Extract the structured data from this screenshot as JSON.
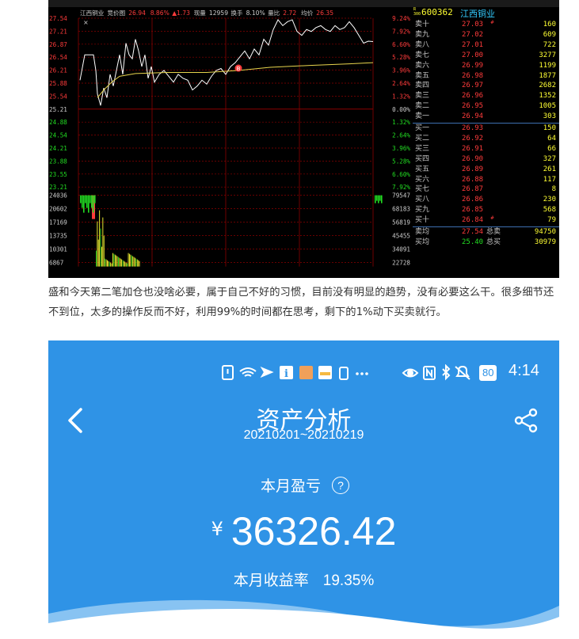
{
  "terminal": {
    "stock_name": "江西铜业",
    "chart_label": "竞价图",
    "header": {
      "price": "26.94",
      "change_pct": "8.86%",
      "change_arrow": "▲",
      "change_amount": "1.73",
      "volume_label": "现量",
      "volume": "12959",
      "turnover_label": "换手",
      "turnover": "8.10%",
      "vol_ratio_label": "量比",
      "vol_ratio": "2.72",
      "avg_label": "均价",
      "avg_price": "26.35"
    },
    "price_axis_left": [
      "27.54",
      "27.21",
      "26.87",
      "26.54",
      "26.21",
      "25.88",
      "25.54",
      "25.21",
      "24.88",
      "24.54",
      "24.21",
      "23.88",
      "23.55",
      "23.21"
    ],
    "price_axis_right": [
      "9.24%",
      "7.92%",
      "6.60%",
      "5.28%",
      "3.96%",
      "2.64%",
      "1.32%",
      "0.00%",
      "1.32%",
      "2.64%",
      "3.96%",
      "5.28%",
      "6.60%",
      "7.92%"
    ],
    "volume_axis_left": [
      "24036",
      "20602",
      "17169",
      "13735",
      "10301",
      "6867"
    ],
    "volume_axis_right": [
      "79547",
      "68183",
      "56819",
      "45455",
      "34091",
      "22728"
    ],
    "buy_marker": "B",
    "book": {
      "code": "600362",
      "code_prefix": "R\n300",
      "name": "江西铜业",
      "sells": [
        {
          "label": "卖十",
          "price": "27.03",
          "flag": "#",
          "vol": "160"
        },
        {
          "label": "卖九",
          "price": "27.02",
          "flag": "",
          "vol": "609"
        },
        {
          "label": "卖八",
          "price": "27.01",
          "flag": "",
          "vol": "722"
        },
        {
          "label": "卖七",
          "price": "27.00",
          "flag": "",
          "vol": "3277"
        },
        {
          "label": "卖六",
          "price": "26.99",
          "flag": "",
          "vol": "1199"
        },
        {
          "label": "卖五",
          "price": "26.98",
          "flag": "",
          "vol": "1877"
        },
        {
          "label": "卖四",
          "price": "26.97",
          "flag": "",
          "vol": "2682"
        },
        {
          "label": "卖三",
          "price": "26.96",
          "flag": "",
          "vol": "1352"
        },
        {
          "label": "卖二",
          "price": "26.95",
          "flag": "",
          "vol": "1005"
        },
        {
          "label": "卖一",
          "price": "26.94",
          "flag": "",
          "vol": "303"
        }
      ],
      "buys": [
        {
          "label": "买一",
          "price": "26.93",
          "flag": "",
          "vol": "150"
        },
        {
          "label": "买二",
          "price": "26.92",
          "flag": "",
          "vol": "64"
        },
        {
          "label": "买三",
          "price": "26.91",
          "flag": "",
          "vol": "66"
        },
        {
          "label": "买四",
          "price": "26.90",
          "flag": "",
          "vol": "327"
        },
        {
          "label": "买五",
          "price": "26.89",
          "flag": "",
          "vol": "261"
        },
        {
          "label": "买六",
          "price": "26.88",
          "flag": "",
          "vol": "117"
        },
        {
          "label": "买七",
          "price": "26.87",
          "flag": "",
          "vol": "8"
        },
        {
          "label": "买八",
          "price": "26.86",
          "flag": "",
          "vol": "230"
        },
        {
          "label": "买九",
          "price": "26.85",
          "flag": "",
          "vol": "568"
        },
        {
          "label": "买十",
          "price": "26.84",
          "flag": "#",
          "vol": "79"
        }
      ],
      "sell_avg": {
        "label": "卖均",
        "price": "27.54",
        "total_label": "总卖",
        "total": "94750"
      },
      "buy_avg": {
        "label": "买均",
        "price": "25.40",
        "total_label": "总买",
        "total": "30979"
      }
    },
    "colors": {
      "red": "#ff3b3b",
      "green": "#22dd22",
      "yellow": "#ffff33",
      "grid": "#8b0000",
      "avg_line": "#e8d44d"
    }
  },
  "paragraph": "盛和今天第二笔加仓也没啥必要，属于自己不好的习惯，目前没有明显的趋势，没有必要这么干。很多细节还不到位，太多的操作反而不好，利用99%的时间都在思考，剩下的1%动下买卖就行。",
  "phone": {
    "status_icons": [
      "alert-icon",
      "wifi-icon",
      "send-icon",
      "info-icon",
      "app-icon",
      "app-icon",
      "sim-alert-icon",
      "more-icon",
      "eye-icon",
      "nfc-icon",
      "bluetooth-icon",
      "mute-icon"
    ],
    "battery": "80",
    "time": "4:14",
    "title": "资产分析",
    "date_range": "20210201~20210219",
    "monthly_pl_label": "本月盈亏",
    "help_icon": "?",
    "currency_symbol": "¥",
    "monthly_pl_value": "36326.42",
    "monthly_return_label": "本月收益率",
    "monthly_return_value": "19.35%",
    "colors": {
      "background": "#2f93e6",
      "wave": "#ffffff"
    }
  }
}
